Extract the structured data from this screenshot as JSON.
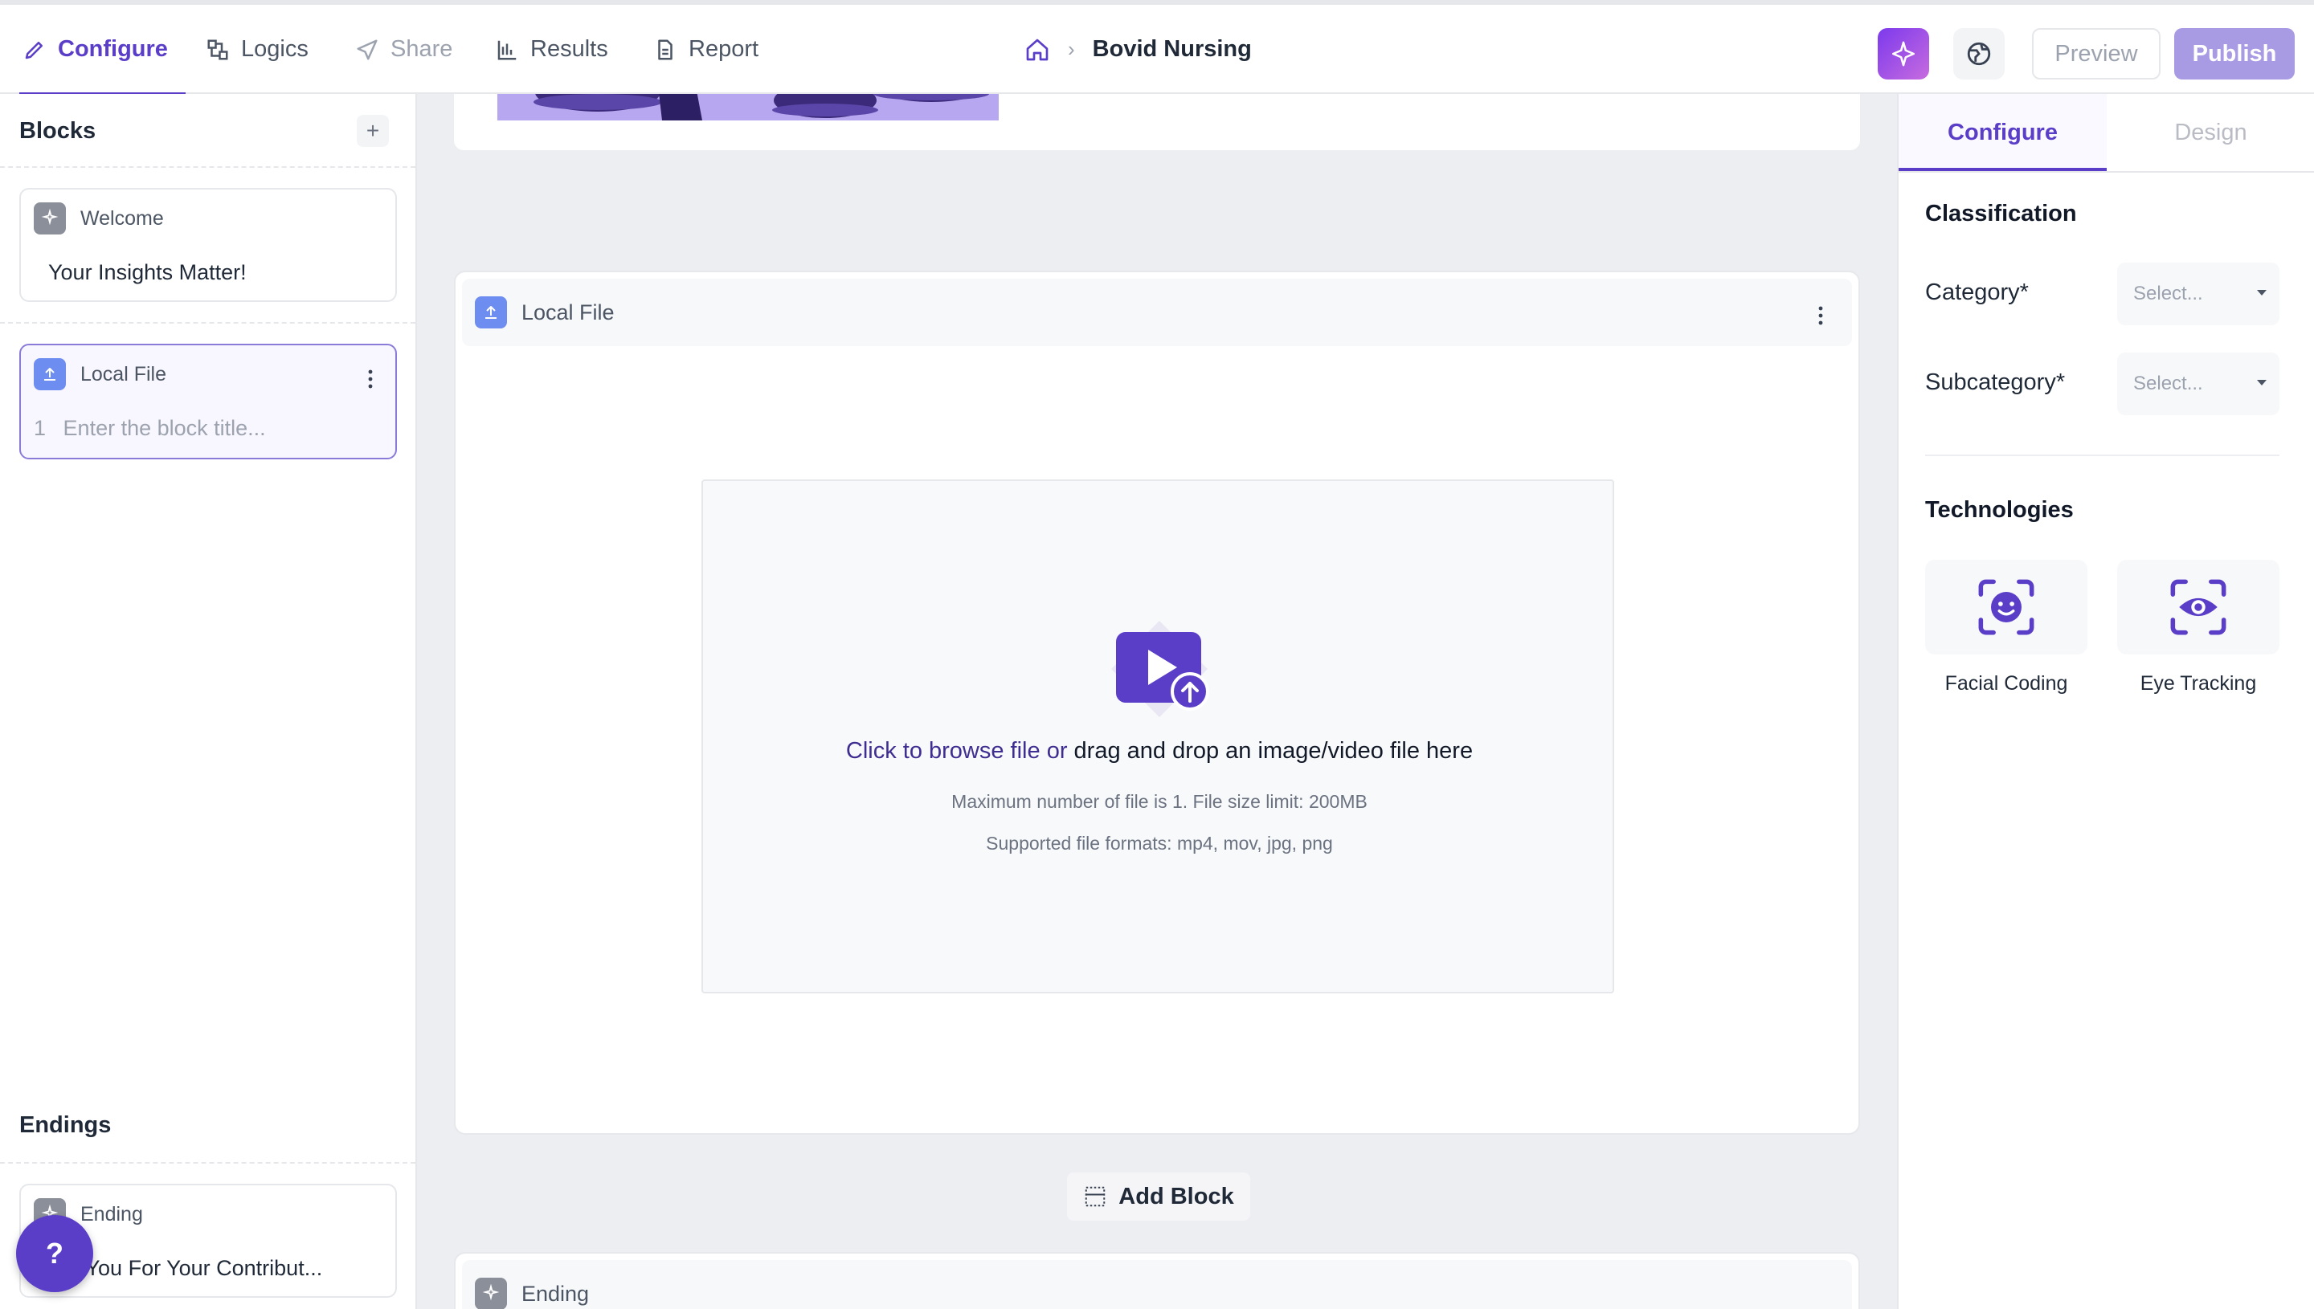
{
  "nav": {
    "tabs": [
      {
        "label": "Configure",
        "icon": "pencil-icon",
        "state": "active"
      },
      {
        "label": "Logics",
        "icon": "logic-flow-icon",
        "state": "normal"
      },
      {
        "label": "Share",
        "icon": "send-icon",
        "state": "disabled"
      },
      {
        "label": "Results",
        "icon": "bar-chart-icon",
        "state": "normal"
      },
      {
        "label": "Report",
        "icon": "document-icon",
        "state": "normal"
      }
    ],
    "breadcrumb": {
      "home_icon": "home-icon",
      "separator": "›",
      "current": "Bovid Nursing"
    },
    "actions": {
      "ai_icon": "sparkle-icon",
      "globe_icon": "globe-icon",
      "preview_label": "Preview",
      "publish_label": "Publish"
    }
  },
  "sidebar": {
    "blocks_title": "Blocks",
    "add_icon": "+",
    "blocks": [
      {
        "type_label": "Welcome",
        "title": "Your Insights Matter!",
        "icon": "sparkle-icon"
      },
      {
        "type_label": "Local File",
        "number": "1",
        "title_placeholder": "Enter the block title...",
        "icon": "upload-icon",
        "active": true
      }
    ],
    "endings_title": "Endings",
    "endings": [
      {
        "type_label": "Ending",
        "title": "k You For Your Contribut...",
        "icon": "sparkle-icon"
      }
    ],
    "help_label": "?"
  },
  "canvas": {
    "block": {
      "type_label": "Local File",
      "upload": {
        "link_text": "Click to browse file or",
        "main_text": " drag and drop an image/video file here",
        "limit_text": "Maximum number of file is 1. File size limit: 200MB",
        "formats_text": "Supported file formats: mp4, mov, jpg, png"
      }
    },
    "add_block_label": "Add Block",
    "ending_block_label": "Ending"
  },
  "right_panel": {
    "tabs": [
      {
        "label": "Configure",
        "active": true
      },
      {
        "label": "Design",
        "active": false
      }
    ],
    "classification": {
      "title": "Classification",
      "category_label": "Category*",
      "category_value": "Select...",
      "subcategory_label": "Subcategory*",
      "subcategory_value": "Select..."
    },
    "technologies": {
      "title": "Technologies",
      "items": [
        {
          "label": "Facial Coding",
          "icon": "face-scan-icon"
        },
        {
          "label": "Eye Tracking",
          "icon": "eye-scan-icon"
        }
      ]
    }
  },
  "colors": {
    "accent": "#5b3ec8",
    "publish_bg": "#a99be3",
    "canvas_bg": "#eceef2",
    "link": "#3f2d91"
  }
}
